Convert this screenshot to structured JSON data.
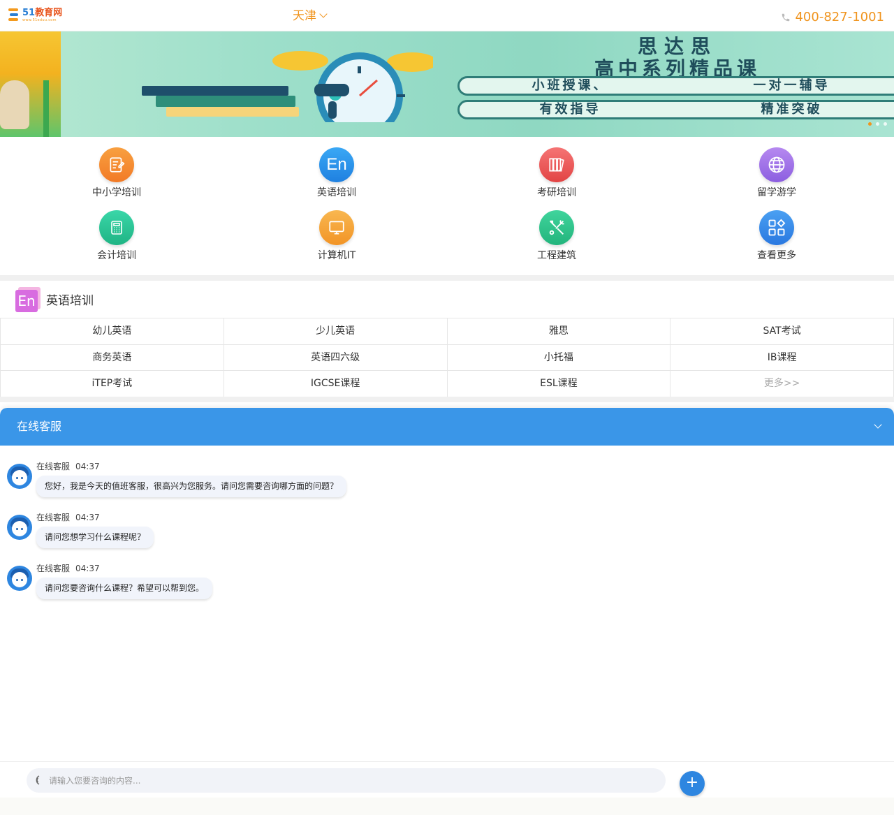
{
  "header": {
    "logo": {
      "name_num": "51",
      "name_text": "教育网",
      "url": "www.51eduu.com"
    },
    "city": "天津",
    "phone": "400-827-1001"
  },
  "banner": {
    "title_line1": "思达思",
    "title_line2": "高中系列精品课",
    "tag1_left": "小班授课、",
    "tag1_right": "一对一辅导",
    "tag2_left": "有效指导",
    "tag2_right": "精准突破"
  },
  "categories": [
    {
      "label": "中小学培训",
      "icon": "notebook-icon",
      "color": "#f5862f"
    },
    {
      "label": "英语培训",
      "icon": "english-en-icon",
      "color": "#2a94ea"
    },
    {
      "label": "考研培训",
      "icon": "books-icon",
      "color": "#ef5a5a"
    },
    {
      "label": "留学游学",
      "icon": "globe-icon",
      "color": "#a070e8"
    },
    {
      "label": "会计培训",
      "icon": "calculator-icon",
      "color": "#2fc79a"
    },
    {
      "label": "计算机IT",
      "icon": "monitor-icon",
      "color": "#f6a43c"
    },
    {
      "label": "工程建筑",
      "icon": "tools-icon",
      "color": "#33c08e"
    },
    {
      "label": "查看更多",
      "icon": "grid-more-icon",
      "color": "#3a8fe8"
    }
  ],
  "english_section": {
    "title": "英语培训",
    "rows": [
      [
        "幼儿英语",
        "少儿英语",
        "雅思",
        "SAT考试"
      ],
      [
        "商务英语",
        "英语四六级",
        "小托福",
        "IB课程"
      ],
      [
        "iTEP考试",
        "IGCSE课程",
        "ESL课程",
        "更多>>"
      ]
    ]
  },
  "chat": {
    "title": "在线客服",
    "messages": [
      {
        "sender": "在线客服",
        "time": "04:37",
        "text": "您好，我是今天的值班客服，很高兴为您服务。请问您需要咨询哪方面的问题？"
      },
      {
        "sender": "在线客服",
        "time": "04:37",
        "text": "请问您想学习什么课程呢？"
      },
      {
        "sender": "在线客服",
        "time": "04:37",
        "text": "请问您要咨询什么课程？希望可以帮到您。"
      }
    ],
    "input_placeholder": "请输入您要咨询的内容...",
    "send_label": "+"
  },
  "colors": {
    "accent_orange": "#f0941e",
    "chat_blue": "#3a96e8"
  }
}
